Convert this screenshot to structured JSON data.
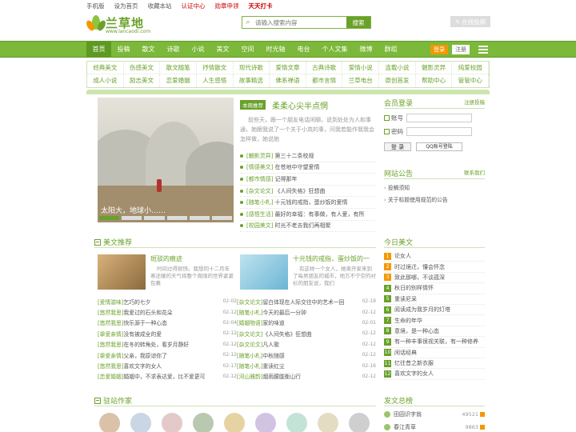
{
  "topbar": {
    "links": [
      "手机版",
      "设为首页",
      "收藏本站",
      "认证中心",
      "勋章申领",
      "天天打卡"
    ]
  },
  "logo": {
    "name": "兰草地",
    "url": "www.lancaodi.com"
  },
  "search": {
    "placeholder": "请输入搜索内容",
    "button": "搜索"
  },
  "submit_button": "在线投稿",
  "nav": {
    "items": [
      "首页",
      "投稿",
      "散文",
      "诗歌",
      "小说",
      "美文",
      "空间",
      "时光轴",
      "电台",
      "个人文集",
      "微博",
      "群组"
    ],
    "active": 0,
    "login": "登录",
    "register": "注册"
  },
  "categories": {
    "row1": [
      "经典美文",
      "伤感美文",
      "散文随笔",
      "抒情散文",
      "现代诗歌",
      "爱情文章",
      "古典诗歌",
      "爱情小说",
      "连载小说",
      "魍影灵异",
      "纯爱校园"
    ],
    "row2": [
      "成人小说",
      "励志美文",
      "恋爱婚姻",
      "人生感悟",
      "故事精选",
      "佛系禅语",
      "都市言情",
      "兰草电台",
      "原创首发",
      "帮助中心",
      "管管中心"
    ]
  },
  "featured": {
    "caption": "太阳大，地球小……",
    "slides": 6,
    "active_slide": 0
  },
  "recommend": {
    "tag": "本周推荐",
    "title": "柔柔心尖半点惘",
    "text": "前些天，跟一个朋友电话闲聊。说到处处为人和事通，她跟我说了一个关于小岚的事，问我若能作我我会怎样做，她说她",
    "list": [
      {
        "cat": "[魍影灵异]",
        "title": "第三十二条校规"
      },
      {
        "cat": "[情感美文]",
        "title": "在苍地中守望爱情"
      },
      {
        "cat": "[都市情感]",
        "title": "记得那年"
      },
      {
        "cat": "[杂文论文]",
        "title": "《人间失格》狂想曲"
      },
      {
        "cat": "[随笔小札]",
        "title": "十元钱的戒指，蛋炒饭的爱情"
      },
      {
        "cat": "[感悟生活]",
        "title": "最好的幸福：有事做，有人爱，有所"
      },
      {
        "cat": "[校园美文]",
        "title": "时光不老去我们再相聚"
      }
    ]
  },
  "member_login": {
    "title": "会员登录",
    "register_link": "注册投稿",
    "account_label": "账号",
    "password_label": "密码",
    "login_button": "登 录",
    "qq_button": "QQ账号登陆"
  },
  "announcements": {
    "title": "网站公告",
    "more": "联系我们",
    "items": [
      "投稿须知",
      "关于标题使用规范的公告"
    ]
  },
  "articles": {
    "title": "美文推荐",
    "left_pic": {
      "title": "斑驳的痕迹",
      "desc": "时间过得很快。我想同十二月年寒还暖的天气将整个周围的世界紧紧包裹"
    },
    "right_pic": {
      "title": "十元钱的戒指，蛋炒饭的一",
      "desc": "有这样一个女人，她离开家来到了每男朋友的城市，地方不宁空的衬衫的朋友说，我们"
    },
    "left_list": [
      {
        "cat": "[爱情滋味]",
        "title": "乞巧的七夕",
        "date": "02-02"
      },
      {
        "cat": "[悠然我思]",
        "title": "我爱过的石头和花朵",
        "date": "02-12"
      },
      {
        "cat": "[悠然我思]",
        "title": "快乐源于一种心态",
        "date": "02-04"
      },
      {
        "cat": "[挚爱亲情]",
        "title": "没有被成全的爱",
        "date": "02-12"
      },
      {
        "cat": "[悠然我思]",
        "title": "在冬的转角处，看岁月静好",
        "date": "02-12"
      },
      {
        "cat": "[挚爱亲情]",
        "title": "父亲，我原谅你了",
        "date": "02-12"
      },
      {
        "cat": "[悠然我思]",
        "title": "喜欢文字的女人",
        "date": "02-17"
      },
      {
        "cat": "[恋爱婚姻]",
        "title": "婚姻中，不求表达爱，比不爱更可",
        "date": "02-12"
      }
    ],
    "right_list": [
      {
        "cat": "[杂文论文]",
        "title": "留白体现在人际交往中的艺术一回",
        "date": "02-19"
      },
      {
        "cat": "[随笔小札]",
        "title": "今天的最后一分钟",
        "date": "02-12"
      },
      {
        "cat": "[婚姻物语]",
        "title": "家的味道",
        "date": "02-01"
      },
      {
        "cat": "[杂文论文]",
        "title": "《人间失格》狂想曲",
        "date": "02-12"
      },
      {
        "cat": "[杂文论文]",
        "title": "凡人歌",
        "date": "02-12"
      },
      {
        "cat": "[随笔小札]",
        "title": "中秋随感",
        "date": "02-12"
      },
      {
        "cat": "[随笔小札]",
        "title": "重读红尘",
        "date": "02-16"
      },
      {
        "cat": "[河山雅韵]",
        "title": "烟雨朦胧衡山行",
        "date": "02-12"
      }
    ]
  },
  "today": {
    "title": "今日美文",
    "items": [
      "论女人",
      "时过境迁，懂会怀念",
      "致此那哪，不谈孤深",
      "秋日的别样情怀",
      "重读尼采",
      "阅读成为我岁月的灯塔",
      "生命的年华",
      "意境，是一种心态",
      "有一种丰事很视关联，有一种修养",
      "闲话经典",
      "忆往昔之新衣服",
      "喜欢文字的女人"
    ]
  },
  "authors": {
    "title": "驻站作家",
    "count": 9
  },
  "ranking": {
    "title": "发文总榜",
    "items": [
      {
        "name": "田园识字翁",
        "value": "49521"
      },
      {
        "name": "春江青草",
        "value": "9863"
      }
    ]
  },
  "colors": {
    "brand": "#7cb839",
    "accent": "#f39800"
  }
}
